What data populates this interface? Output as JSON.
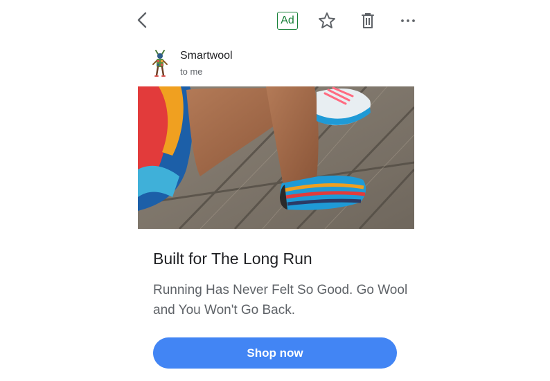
{
  "topbar": {
    "back_icon": "chevron-left-icon",
    "ad_label": "Ad",
    "star_icon": "star-outline-icon",
    "trash_icon": "trash-icon",
    "more_icon": "more-horizontal-icon"
  },
  "sender": {
    "name": "Smartwool",
    "recipient": "to me",
    "avatar_icon": "smartwool-logo"
  },
  "ad": {
    "hero_image": "running-socks-photo",
    "headline": "Built for The Long Run",
    "description": "Running Has Never Felt So Good. Go Wool and You Won't Go Back.",
    "cta_label": "Shop now"
  },
  "colors": {
    "ad_badge": "#188038",
    "cta_background": "#4285f4",
    "headline_text": "#202124",
    "secondary_text": "#5f6368"
  }
}
